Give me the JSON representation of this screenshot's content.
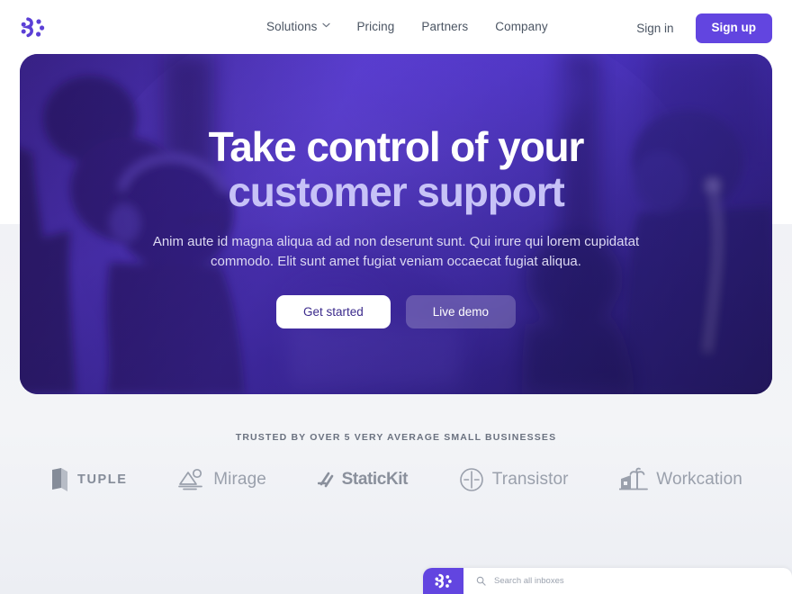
{
  "brand": {
    "logo_icon": "molecule-dots-logo",
    "accent_color": "#6245e0"
  },
  "nav": {
    "links": [
      {
        "label": "Solutions",
        "has_dropdown": true,
        "icon": "chevron-down-icon"
      },
      {
        "label": "Pricing",
        "has_dropdown": false
      },
      {
        "label": "Partners",
        "has_dropdown": false
      },
      {
        "label": "Company",
        "has_dropdown": false
      }
    ],
    "sign_in_label": "Sign in",
    "sign_up_label": "Sign up"
  },
  "hero": {
    "heading_line1": "Take control of your",
    "heading_line2": "customer support",
    "subheading": "Anim aute id magna aliqua ad ad non deserunt sunt. Qui irure qui lorem cupidatat commodo. Elit sunt amet fugiat veniam occaecat fugiat aliqua.",
    "primary_cta": "Get started",
    "secondary_cta": "Live demo",
    "background_image": "duotone-purple-photo-call-center-team"
  },
  "social_proof": {
    "eyebrow": "TRUSTED BY OVER 5 VERY AVERAGE SMALL BUSINESSES",
    "logos": [
      {
        "name": "Tuple",
        "wordmark": "TUPLE",
        "icon": "tuple-card-icon"
      },
      {
        "name": "Mirage",
        "wordmark": "Mirage",
        "icon": "mirage-mountain-icon"
      },
      {
        "name": "StaticKit",
        "wordmark": "StaticKit",
        "icon": "statickit-slash-icon"
      },
      {
        "name": "Transistor",
        "wordmark": "Transistor",
        "icon": "transistor-circle-icon"
      },
      {
        "name": "Workcation",
        "wordmark": "Workcation",
        "icon": "workcation-house-palm-icon"
      }
    ]
  },
  "app_preview": {
    "logo_icon": "molecule-dots-logo",
    "search_icon": "search-icon",
    "search_placeholder": "Search all inboxes"
  }
}
